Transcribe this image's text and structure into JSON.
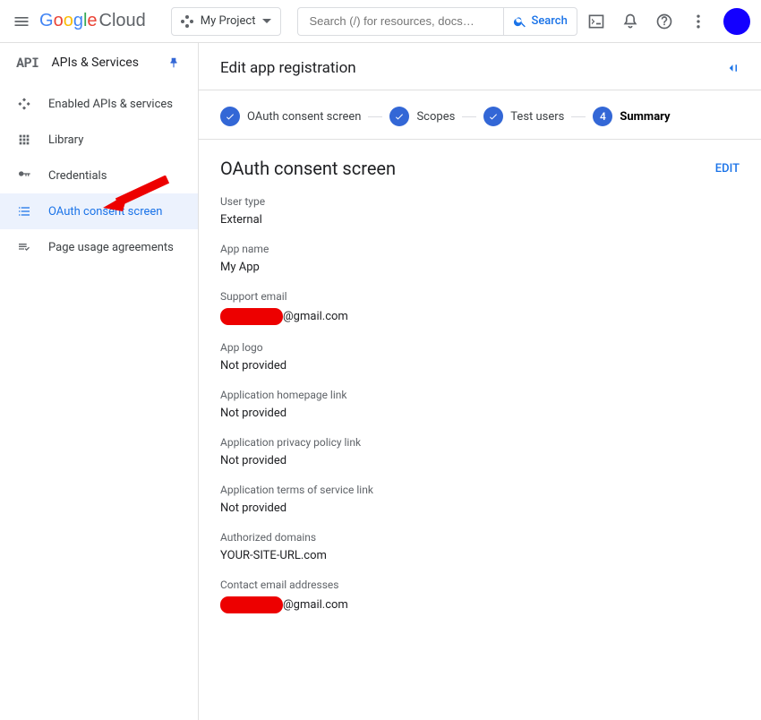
{
  "header": {
    "logo_cloud": "Cloud",
    "project_name": "My Project",
    "search_placeholder": "Search (/) for resources, docs…",
    "search_btn": "Search"
  },
  "sidebar": {
    "title": "APIs & Services",
    "items": [
      {
        "label": "Enabled APIs & services"
      },
      {
        "label": "Library"
      },
      {
        "label": "Credentials"
      },
      {
        "label": "OAuth consent screen"
      },
      {
        "label": "Page usage agreements"
      }
    ]
  },
  "page": {
    "title": "Edit app registration"
  },
  "steps": {
    "s1": "OAuth consent screen",
    "s2": "Scopes",
    "s3": "Test users",
    "s4_num": "4",
    "s4": "Summary"
  },
  "section": {
    "title": "OAuth consent screen",
    "edit": "EDIT"
  },
  "fields": {
    "user_type_label": "User type",
    "user_type_value": "External",
    "app_name_label": "App name",
    "app_name_value": "My App",
    "support_email_label": "Support email",
    "support_email_suffix": "@gmail.com",
    "app_logo_label": "App logo",
    "app_logo_value": "Not provided",
    "homepage_label": "Application homepage link",
    "homepage_value": "Not provided",
    "privacy_label": "Application privacy policy link",
    "privacy_value": "Not provided",
    "tos_label": "Application terms of service link",
    "tos_value": "Not provided",
    "auth_domains_label": "Authorized domains",
    "auth_domains_value": "YOUR-SITE-URL.com",
    "contact_label": "Contact email addresses",
    "contact_suffix": "@gmail.com"
  }
}
